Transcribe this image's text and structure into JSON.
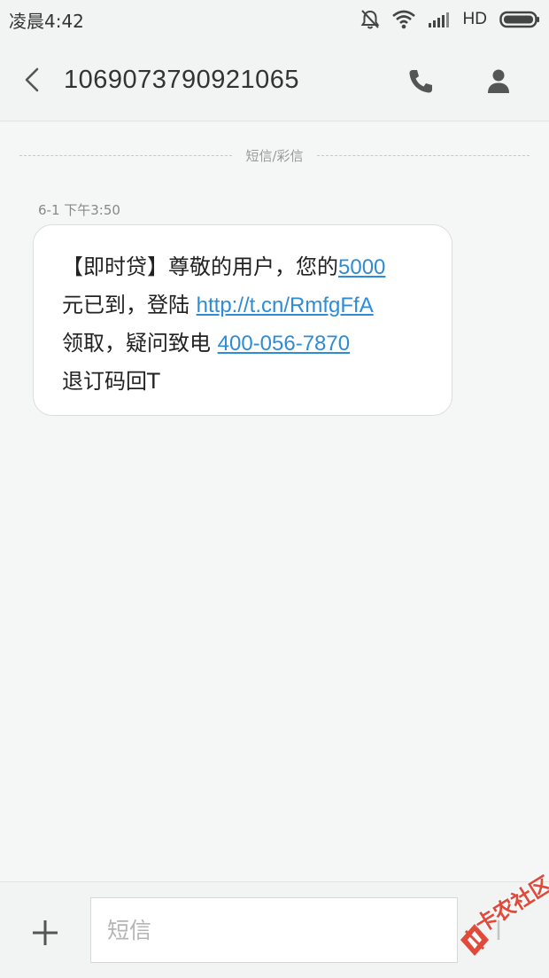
{
  "status_bar": {
    "time": "凌晨4:42",
    "network": "HD",
    "icons": [
      "alarm-off-icon",
      "wifi-icon",
      "signal-icon",
      "battery-icon"
    ]
  },
  "header": {
    "back_icon": "chevron-left-icon",
    "title": "1069073790921065",
    "call_icon": "phone-icon",
    "contact_icon": "person-icon"
  },
  "conversation": {
    "divider_label": "短信/彩信",
    "messages": [
      {
        "timestamp": "6-1 下午3:50",
        "lines": [
          {
            "text": "【即时贷】尊敬的用户，您的",
            "link": "5000"
          },
          {
            "text": "元已到，登陆 ",
            "link": "http://t.cn/RmfgFfA"
          },
          {
            "text": "领取，疑问致电 ",
            "link": "400-056-7870"
          },
          {
            "text": "退订码回T",
            "link": ""
          }
        ]
      }
    ]
  },
  "input_bar": {
    "add_icon": "plus-icon",
    "placeholder": "短信",
    "value": ""
  },
  "watermark": {
    "text": "卡农社区"
  },
  "colors": {
    "link": "#2e8cd6",
    "background": "#f5f6f6",
    "bubble": "#ffffff",
    "watermark": "#e04a3b"
  }
}
